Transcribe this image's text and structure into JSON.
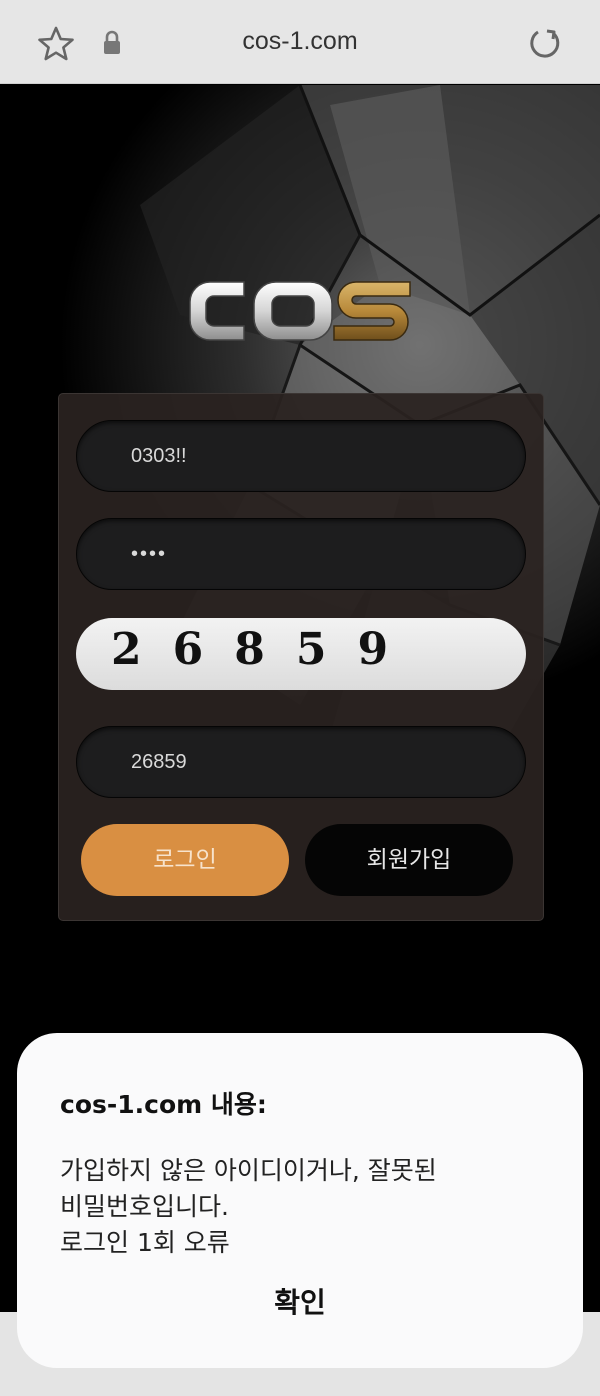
{
  "browser": {
    "url": "cos-1.com",
    "icons": [
      "star-icon",
      "lock-icon",
      "reload-icon"
    ]
  },
  "login_form": {
    "id_value": "0303!!",
    "password_masked": "••••",
    "captcha_digits": "26859",
    "captcha_input_value": "26859",
    "login_label": "로그인",
    "join_label": "회원가입"
  },
  "dialog": {
    "title": "cos-1.com 내용:",
    "message_lines": [
      "가입하지 않은 아이디이거나, 잘못된",
      "비밀번호입니다.",
      "로그인 1회 오류"
    ],
    "ok_label": "확인"
  },
  "colors": {
    "login_button": "#d98f42",
    "logo_gold": "#b8893a"
  }
}
